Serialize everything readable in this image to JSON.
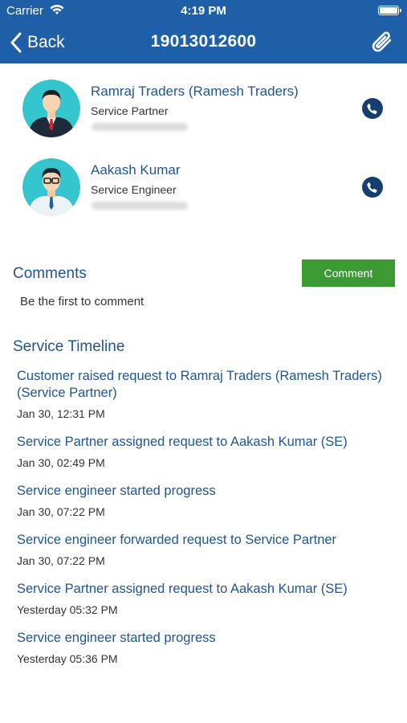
{
  "status_bar": {
    "carrier": "Carrier",
    "time": "4:19 PM"
  },
  "nav": {
    "back_label": "Back",
    "title": "19013012600"
  },
  "contacts": [
    {
      "name": "Ramraj Traders (Ramesh Traders)",
      "role": "Service Partner",
      "tie_color": "#d0262e"
    },
    {
      "name": "Aakash Kumar",
      "role": "Service Engineer",
      "tie_color": "#1f5fa8"
    }
  ],
  "comments": {
    "heading": "Comments",
    "button_label": "Comment",
    "empty_text": "Be the first to comment"
  },
  "timeline": {
    "heading": "Service Timeline",
    "events": [
      {
        "text": "Customer raised request  to Ramraj Traders (Ramesh Traders) (Service Partner)",
        "date": "Jan 30, 12:31 PM"
      },
      {
        "text": "Service Partner assigned request to Aakash Kumar (SE)",
        "date": "Jan 30, 02:49 PM"
      },
      {
        "text": "Service engineer started progress",
        "date": "Jan 30, 07:22 PM"
      },
      {
        "text": "Service engineer forwarded request to Service Partner",
        "date": "Jan 30, 07:22 PM"
      },
      {
        "text": "Service Partner assigned request to Aakash Kumar (SE)",
        "date": "Yesterday 05:32 PM"
      },
      {
        "text": "Service engineer started progress",
        "date": "Yesterday 05:36 PM"
      }
    ]
  },
  "colors": {
    "header_blue": "#1f5fa8",
    "text_blue": "#1f5495",
    "comment_green": "#3c9a33",
    "avatar_teal": "#35c5cf"
  }
}
